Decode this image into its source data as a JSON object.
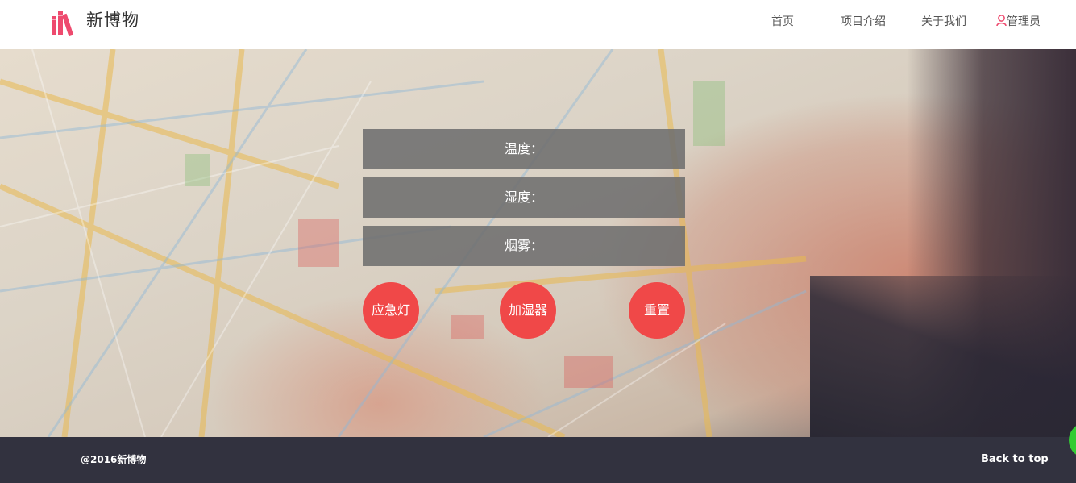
{
  "header": {
    "brand": "新博物",
    "nav": {
      "home": "首页",
      "project": "项目介绍",
      "about": "关于我们",
      "admin": "管理员"
    }
  },
  "readouts": {
    "temperature": "温度：",
    "humidity": "湿度：",
    "smoke": "烟雾："
  },
  "actions": {
    "emergency_light": "应急灯",
    "humidifier": "加湿器",
    "reset": "重置"
  },
  "footer": {
    "copyright": "@2016新博物",
    "back_to_top": "Back to top"
  },
  "colors": {
    "accent": "#f04848",
    "logo": "#ee4a6e",
    "footer_bg": "#32323f",
    "panel_bg": "#6e6e6e"
  },
  "icons": {
    "logo": "books-icon",
    "admin": "user-icon"
  }
}
